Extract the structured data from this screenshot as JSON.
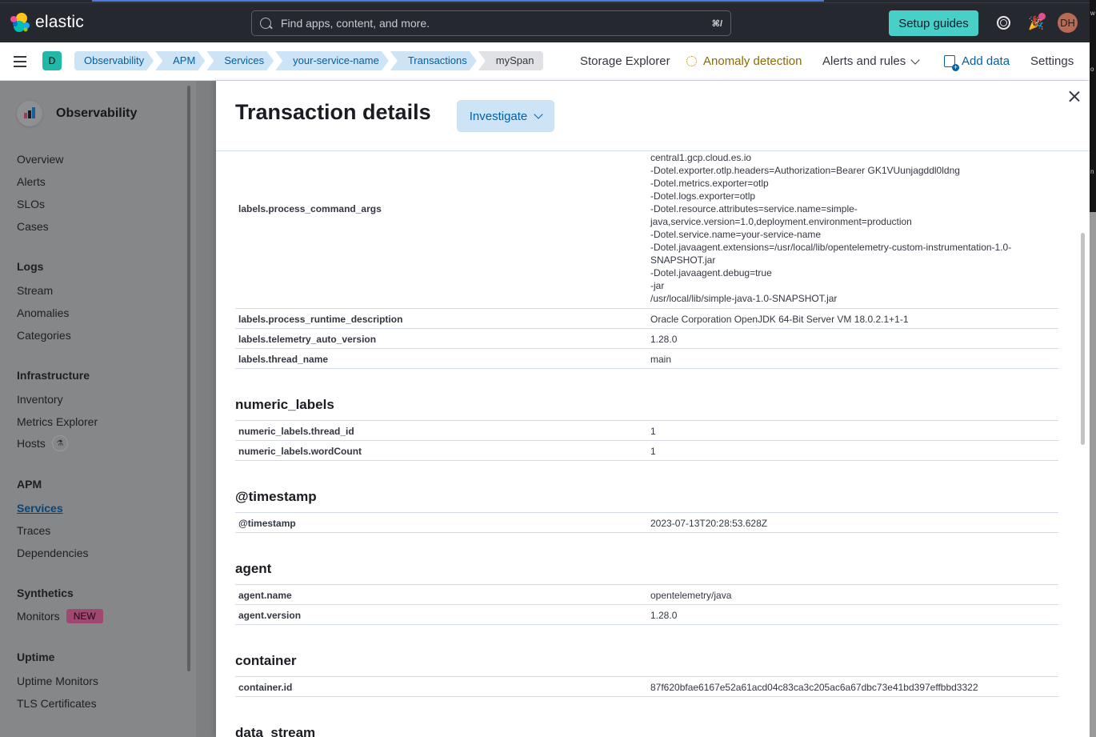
{
  "header": {
    "brand": "elastic",
    "search_placeholder": "Find apps, content, and more.",
    "search_shortcut": "⌘/",
    "setup_guides_label": "Setup guides",
    "avatar_initials": "DH",
    "space_initial": "D"
  },
  "breadcrumbs": [
    "Observability",
    "APM",
    "Services",
    "your-service-name",
    "Transactions",
    "mySpan"
  ],
  "nav_links": {
    "storage_explorer": "Storage Explorer",
    "anomaly_detection": "Anomaly detection",
    "alerts_and_rules": "Alerts and rules",
    "add_data": "Add data",
    "settings": "Settings"
  },
  "sidebar": {
    "title": "Observability",
    "top_items": [
      "Overview",
      "Alerts",
      "SLOs",
      "Cases"
    ],
    "sections": [
      {
        "label": "Logs",
        "items": [
          "Stream",
          "Anomalies",
          "Categories"
        ]
      },
      {
        "label": "Infrastructure",
        "items": [
          "Inventory",
          "Metrics Explorer",
          "Hosts"
        ]
      },
      {
        "label": "APM",
        "items": [
          "Services",
          "Traces",
          "Dependencies"
        ]
      },
      {
        "label": "Synthetics",
        "items": [
          "Monitors"
        ]
      },
      {
        "label": "Uptime",
        "items": [
          "Uptime Monitors",
          "TLS Certificates"
        ]
      }
    ],
    "active_item": "Services",
    "new_badge": "NEW",
    "beta_icon": "flask-icon"
  },
  "flyout": {
    "title": "Transaction details",
    "investigate_label": "Investigate",
    "command_args": {
      "key": "labels.process_command_args",
      "lines": [
        "central1.gcp.cloud.es.io",
        "-Dotel.exporter.otlp.headers=Authorization=Bearer GK1VUunjagddl0ldng",
        "-Dotel.metrics.exporter=otlp",
        "-Dotel.logs.exporter=otlp",
        "-Dotel.resource.attributes=service.name=simple-",
        "java,service.version=1.0,deployment.environment=production",
        "-Dotel.service.name=your-service-name",
        "-Dotel.javaagent.extensions=/usr/local/lib/opentelemetry-custom-instrumentation-1.0-",
        "SNAPSHOT.jar",
        "-Dotel.javaagent.debug=true",
        "-jar",
        "/usr/local/lib/simple-java-1.0-SNAPSHOT.jar"
      ]
    },
    "labels_rows": [
      {
        "key": "labels.process_runtime_description",
        "value": "Oracle Corporation OpenJDK 64-Bit Server VM 18.0.2.1+1-1"
      },
      {
        "key": "labels.telemetry_auto_version",
        "value": "1.28.0"
      },
      {
        "key": "labels.thread_name",
        "value": "main"
      }
    ],
    "sections": [
      {
        "title": "numeric_labels",
        "rows": [
          {
            "key": "numeric_labels.thread_id",
            "value": "1"
          },
          {
            "key": "numeric_labels.wordCount",
            "value": "1"
          }
        ]
      },
      {
        "title": "@timestamp",
        "rows": [
          {
            "key": "@timestamp",
            "value": "2023-07-13T20:28:53.628Z"
          }
        ]
      },
      {
        "title": "agent",
        "rows": [
          {
            "key": "agent.name",
            "value": "opentelemetry/java"
          },
          {
            "key": "agent.version",
            "value": "1.28.0"
          }
        ]
      },
      {
        "title": "container",
        "rows": [
          {
            "key": "container.id",
            "value": "87f620bfae6167e52a61acd04c83ca3c205ac6a67dbc73e41bd397effbbd3322"
          }
        ]
      },
      {
        "title": "data_stream",
        "rows": []
      }
    ]
  }
}
